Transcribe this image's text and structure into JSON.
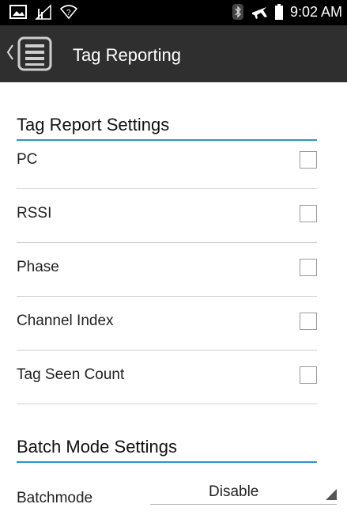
{
  "status_bar": {
    "time": "9:02 AM"
  },
  "app_bar": {
    "title": "Tag Reporting"
  },
  "tag_report": {
    "header": "Tag Report Settings",
    "items": [
      {
        "label": "PC",
        "checked": false
      },
      {
        "label": "RSSI",
        "checked": false
      },
      {
        "label": "Phase",
        "checked": false
      },
      {
        "label": "Channel Index",
        "checked": false
      },
      {
        "label": "Tag Seen Count",
        "checked": false
      }
    ]
  },
  "batch_mode": {
    "header": "Batch Mode Settings",
    "label": "Batchmode",
    "selected": "Disable"
  },
  "colors": {
    "accent": "#2b95c8",
    "status_bar": "#000000",
    "app_bar": "#2f2f2f"
  }
}
